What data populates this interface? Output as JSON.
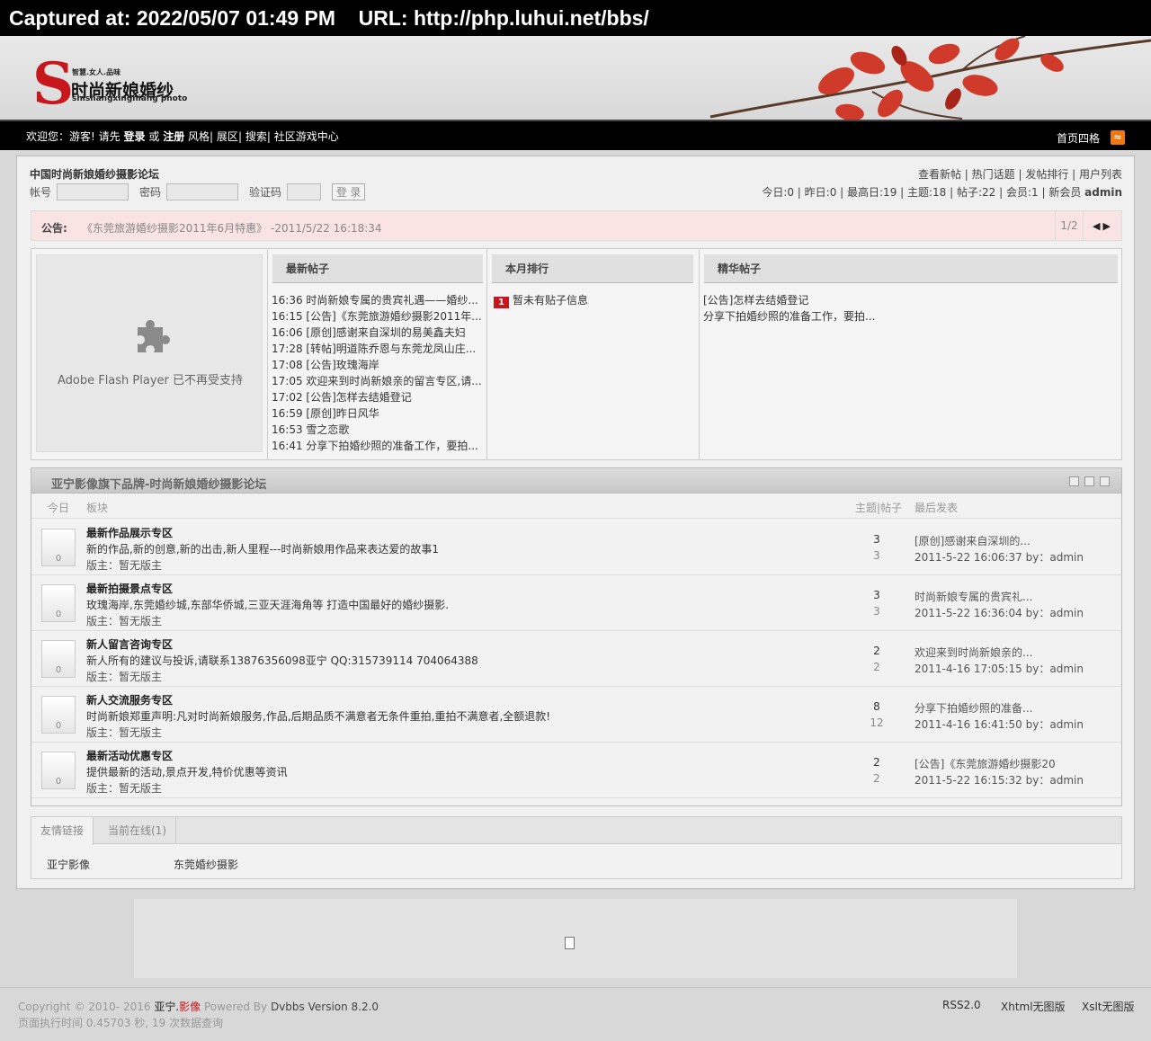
{
  "capture_bar": {
    "text": "Captured at: 2022/05/07 01:49 PM    URL: http://php.luhui.net/bbs/"
  },
  "banner": {
    "logo_letter": "S",
    "logo_tagline": "智慧.女人.品味",
    "logo_cn": "时尚新娘婚纱",
    "logo_en": "shishangxingniang photo"
  },
  "navbar": {
    "welcome": "欢迎您：",
    "guest": "游客!",
    "please": "请先",
    "login": "登录",
    "or": "或",
    "register": "注册",
    "style": "风格",
    "sep": "|",
    "expo": "展区",
    "search": "搜索",
    "game_center": "社区游戏中心",
    "home_style": "首页四格",
    "rss_icon": "rss-icon"
  },
  "header": {
    "forum_title": "中国时尚新娘婚纱摄影论坛",
    "account_label": "帐号",
    "password_label": "密码",
    "captcha_label": "验证码",
    "login_button": "登 录",
    "top_links": "查看新帖 | 热门话题 | 发帖排行 | 用户列表",
    "stats_text": "今日:0 | 昨日:0 | 最高日:19 | 主题:18 | 帖子:22 | 会员:1 | 新会员 ",
    "new_member": "admin"
  },
  "notice": {
    "label": "公告:",
    "title": "《东莞旅游婚纱摄影2011年6月特惠》",
    "time": " -2011/5/22 16:18:34",
    "page": "1/2",
    "arrows": "◀▶"
  },
  "flash": {
    "message": "Adobe Flash Player 已不再受支持",
    "icon": "puzzle-icon"
  },
  "latest_posts": {
    "heading": "最新帖子",
    "items": [
      "16:36 时尚新娘专属的贵宾礼遇——婚纱...",
      "16:15 [公告]《东莞旅游婚纱摄影2011年...",
      "16:06 [原创]感谢来自深圳的易美鑫夫妇",
      "17:28 [转帖]明道陈乔恩与东莞龙凤山庄...",
      "17:08 [公告]玫瑰海岸",
      "17:05 欢迎来到时尚新娘亲的留言专区,请...",
      "17:02 [公告]怎样去结婚登记",
      "16:59 [原创]昨日风华",
      "16:53 雪之恋歌",
      "16:41 分享下拍婚纱照的准备工作，要拍..."
    ]
  },
  "monthly_rank": {
    "heading": "本月排行",
    "badge": "1",
    "empty_text": "暂未有贴子信息"
  },
  "featured_posts": {
    "heading": "精华帖子",
    "items": [
      "[公告]怎样去结婚登记",
      "分享下拍婚纱照的准备工作，要拍..."
    ]
  },
  "board": {
    "title": "亚宁影像旗下品牌-时尚新娘婚纱摄影论坛",
    "col_today": "今日",
    "col_board": "板块",
    "col_topics_posts": "主题|帖子",
    "col_last": "最后发表",
    "forums": [
      {
        "name": "最新作品展示专区",
        "desc": "新的作品,新的创意,新的出击,新人里程---时尚新娘用作品来表达爱的故事1",
        "moderator": "版主：暂无版主",
        "today": "0",
        "topics": "3",
        "posts": "3",
        "last_title": "[原创]感谢来自深圳的...",
        "last_info": "2011-5-22 16:06:37 by：admin"
      },
      {
        "name": "最新拍摄景点专区",
        "desc": "玫瑰海岸,东莞婚纱城,东部华侨城,三亚天涯海角等 打造中国最好的婚纱摄影.",
        "moderator": "版主：暂无版主",
        "today": "0",
        "topics": "3",
        "posts": "3",
        "last_title": "时尚新娘专属的贵宾礼...",
        "last_info": "2011-5-22 16:36:04 by：admin"
      },
      {
        "name": "新人留言咨询专区",
        "desc": "新人所有的建议与投诉,请联系13876356098亚宁 QQ:315739114 704064388",
        "moderator": "版主：暂无版主",
        "today": "0",
        "topics": "2",
        "posts": "2",
        "last_title": "欢迎来到时尚新娘亲的...",
        "last_info": "2011-4-16 17:05:15 by：admin"
      },
      {
        "name": "新人交流服务专区",
        "desc": "时尚新娘郑重声明:凡对时尚新娘服务,作品,后期品质不满意者无条件重拍,重拍不满意者,全额退款!",
        "moderator": "版主：暂无版主",
        "today": "0",
        "topics": "8",
        "posts": "12",
        "last_title": "分享下拍婚纱照的准备...",
        "last_info": "2011-4-16 16:41:50 by：admin"
      },
      {
        "name": "最新活动优惠专区",
        "desc": "提供最新的活动,景点开发,特价优惠等资讯",
        "moderator": "版主：暂无版主",
        "today": "0",
        "topics": "2",
        "posts": "2",
        "last_title": "[公告]《东莞旅游婚纱摄影20",
        "last_info": "2011-5-22 16:15:32 by：admin"
      }
    ]
  },
  "links": {
    "tab_friends": "友情链接",
    "tab_online": "当前在线(1)",
    "items": [
      "亚宁影像",
      "东莞婚纱摄影"
    ]
  },
  "footer": {
    "copyright": "Copyright © 2010- 2016 ",
    "brand_a": "亚宁.",
    "brand_b": "影像",
    "powered": "  Powered By ",
    "version": "Dvbbs Version 8.2.0",
    "exec_time": "页面执行时间 0.45703 秒, 19 次数据查询",
    "rss": "RSS2.0",
    "xhtml": "Xhtml无图版",
    "xslt": "Xslt无图版"
  },
  "colors": {
    "accent_red": "#c8161d",
    "notice_bg": "#f9e3e3",
    "navbar_bg": "#000000"
  }
}
